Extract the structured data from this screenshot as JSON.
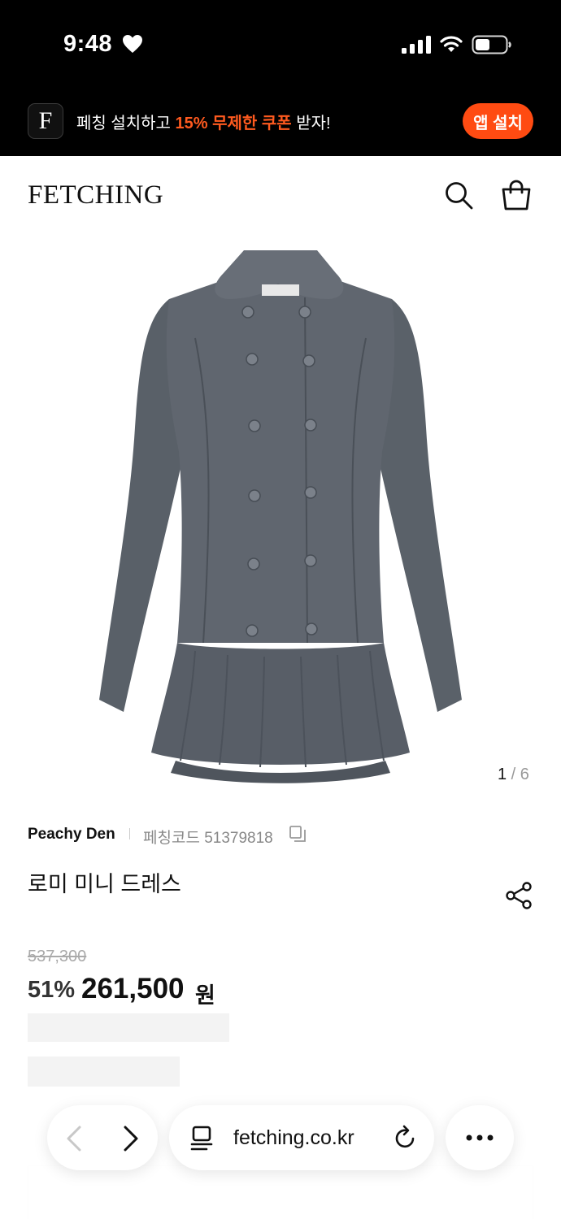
{
  "status_bar": {
    "time": "9:48"
  },
  "banner": {
    "app_letter": "F",
    "text_before": "페칭 설치하고 ",
    "text_highlight": "15% 무제한 쿠폰",
    "text_after": " 받자!",
    "install_label": "앱 설치"
  },
  "header": {
    "logo": "FETCHING"
  },
  "gallery": {
    "current": "1",
    "separator": " / ",
    "total": "6"
  },
  "product": {
    "brand": "Peachy Den",
    "code_label": "페칭코드 51379818",
    "name": "로미 미니 드레스",
    "original_price": "537,300",
    "discount": "51%",
    "sale_price": "261,500",
    "currency": "원"
  },
  "browser": {
    "url": "fetching.co.kr"
  },
  "colors": {
    "accent": "#ff4b12",
    "banner_bg": "#000000",
    "dress": "#5b5f68"
  }
}
